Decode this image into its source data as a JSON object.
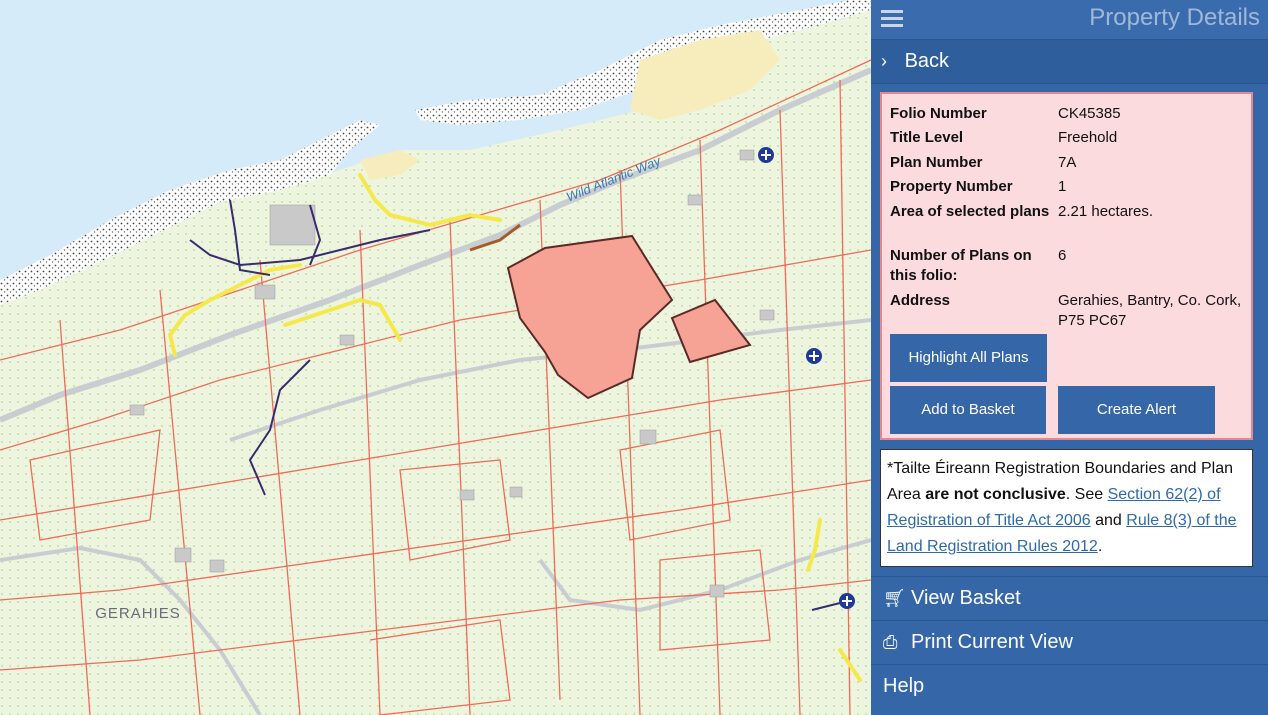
{
  "map": {
    "place_label": "GERAHIES",
    "road_label": "Wild Atlantic Way",
    "colors": {
      "sea": "#d6ebfa",
      "land": "#eef5df",
      "beach": "#f6ecbc",
      "boundary": "#ee6b58",
      "road": "#c8cdd2",
      "parcel": "#f6a295",
      "parcel_outline": "#5a2b26",
      "lane": "#f4e84a",
      "track": "#3a2a6e",
      "marker": "#1f3a96"
    }
  },
  "panel": {
    "title": "Property Details",
    "back_label": "Back",
    "details": [
      {
        "key": "Folio Number",
        "value": "CK45385"
      },
      {
        "key": "Title Level",
        "value": "Freehold"
      },
      {
        "key": "Plan Number",
        "value": "7A"
      },
      {
        "key": "Property Number",
        "value": "1"
      },
      {
        "key": "Area of selected plans",
        "value": "2.21 hectares."
      },
      {
        "key": "Number of Plans on this folio:",
        "value": "6"
      },
      {
        "key": "Address",
        "value": "Gerahies, Bantry, Co. Cork, P75 PC67"
      }
    ],
    "buttons": {
      "highlight_all": "Highlight All Plans",
      "add_to_basket": "Add to Basket",
      "create_alert": "Create Alert"
    },
    "notice": {
      "prefix": "*Tailte Éireann Registration Boundaries and Plan Area ",
      "bold": "are not conclusive",
      "mid": ". See ",
      "link1": "Section 62(2) of Registration of Title Act 2006",
      "and": " and ",
      "link2": "Rule 8(3) of the Land Registration Rules 2012",
      "suffix": "."
    },
    "nav": {
      "view_basket": "View Basket",
      "print_view": "Print Current View",
      "help": "Help"
    },
    "colors": {
      "panel": "#3567a8",
      "details_bg": "#fbdbdd",
      "details_border": "#e9868d"
    }
  }
}
